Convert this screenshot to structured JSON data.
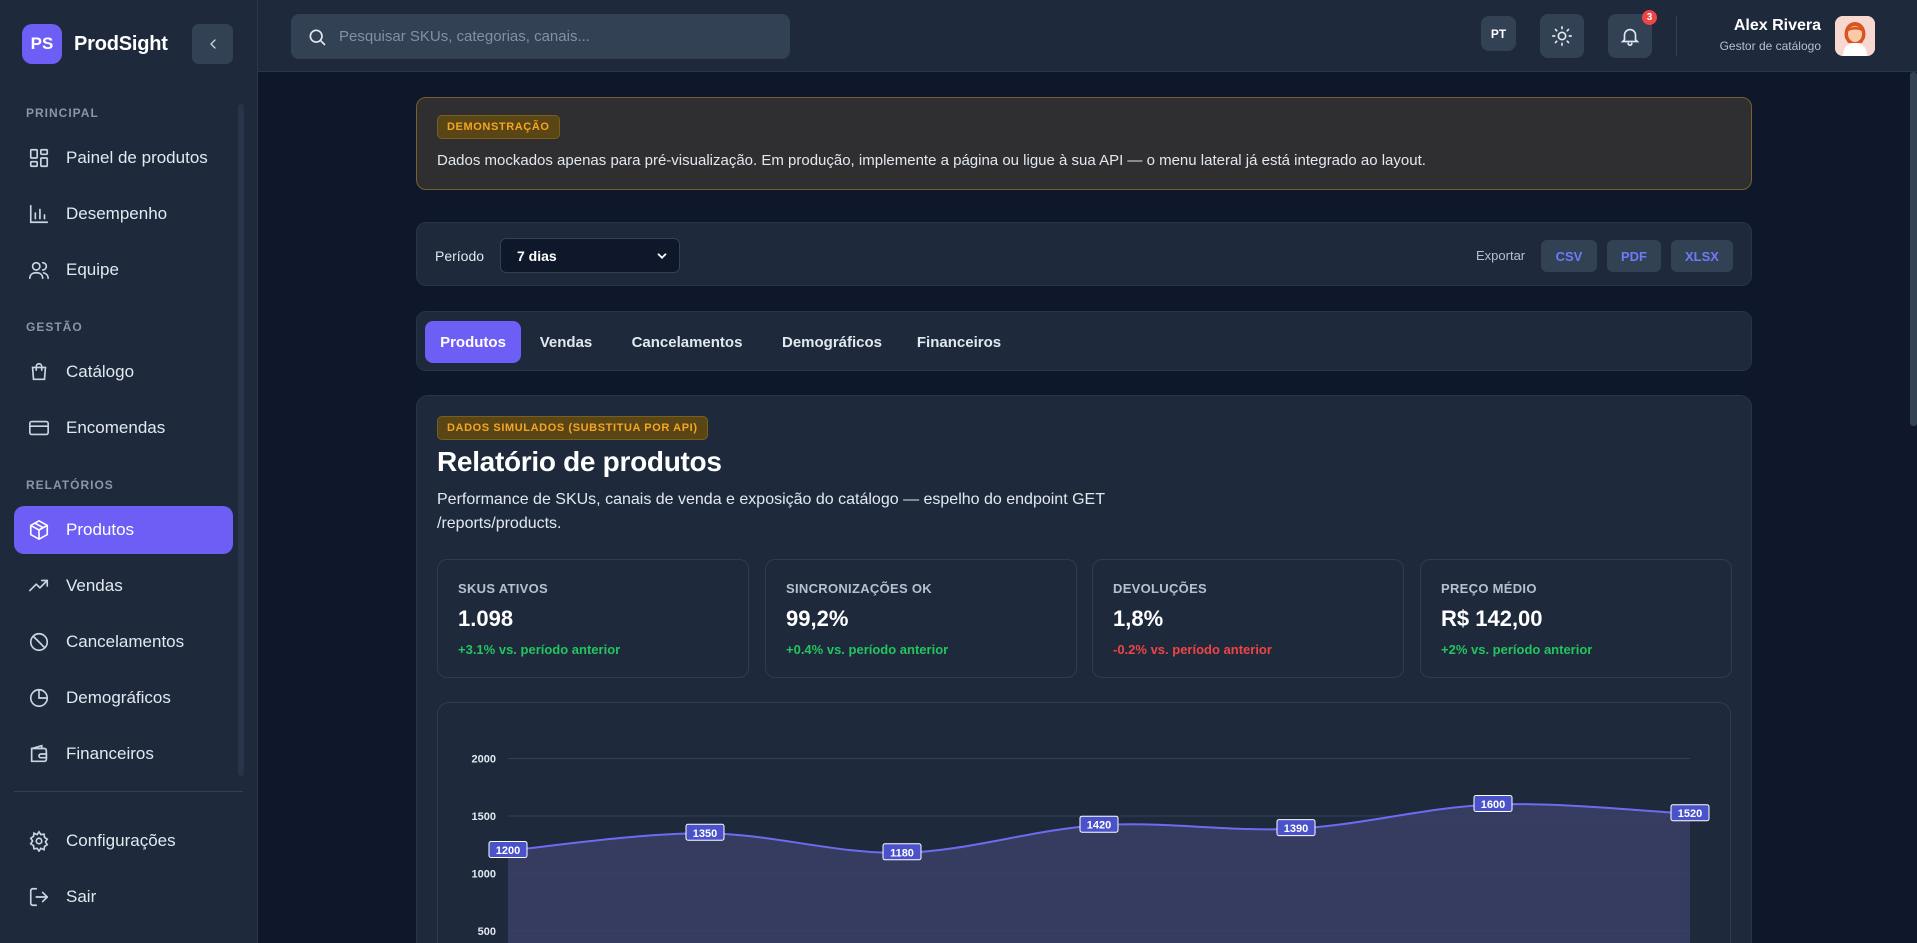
{
  "brand": {
    "logo": "PS",
    "name": "ProdSight"
  },
  "sidebar": {
    "sections": {
      "principal": "PRINCIPAL",
      "gestao": "GESTÃO",
      "relatorios": "RELATÓRIOS"
    },
    "items": {
      "painel": "Painel de produtos",
      "desempenho": "Desempenho",
      "equipe": "Equipe",
      "catalogo": "Catálogo",
      "encomendas": "Encomendas",
      "produtos": "Produtos",
      "vendas": "Vendas",
      "cancelamentos": "Cancelamentos",
      "demograficos": "Demográficos",
      "financeiros": "Financeiros",
      "configuracoes": "Configurações",
      "sair": "Sair"
    },
    "active_item": "Produtos"
  },
  "topbar": {
    "search_placeholder": "Pesquisar SKUs, categorias, canais...",
    "language": "PT",
    "notifications_count": "3",
    "user_name": "Alex Rivera",
    "user_role": "Gestor de catálogo"
  },
  "banner": {
    "badge": "DEMONSTRAÇÃO",
    "text": "Dados mockados apenas para pré-visualização. Em produção, implemente a página ou ligue à sua API — o menu lateral já está integrado ao layout."
  },
  "filters": {
    "period_label": "Período",
    "period_value": "7 dias",
    "export_label": "Exportar",
    "export_buttons": [
      "CSV",
      "PDF",
      "XLSX"
    ]
  },
  "tabs": [
    "Produtos",
    "Vendas",
    "Cancelamentos",
    "Demográficos",
    "Financeiros"
  ],
  "report": {
    "badge": "DADOS SIMULADOS (SUBSTITUA POR API)",
    "title": "Relatório de produtos",
    "subtitle": "Performance de SKUs, canais de venda e exposição do catálogo — espelho do endpoint GET /reports/products.",
    "kpis": [
      {
        "label": "SKUS ATIVOS",
        "value": "1.098",
        "delta": "+3.1% vs. período anterior",
        "trend": "up"
      },
      {
        "label": "SINCRONIZAÇÕES OK",
        "value": "99,2%",
        "delta": "+0.4% vs. período anterior",
        "trend": "up"
      },
      {
        "label": "DEVOLUÇÕES",
        "value": "1,8%",
        "delta": "-0.2% vs. período anterior",
        "trend": "down"
      },
      {
        "label": "PREÇO MÉDIO",
        "value": "R$ 142,00",
        "delta": "+2% vs. período anterior",
        "trend": "up"
      }
    ]
  },
  "chart_data": {
    "type": "area",
    "y_ticks": [
      2000,
      1500,
      1000,
      500
    ],
    "ylim": [
      0,
      2000
    ],
    "values": [
      1200,
      1350,
      1180,
      1420,
      1390,
      1600,
      1520
    ],
    "grid": true,
    "line_color": "#6d6cf0",
    "fill_color": "#3a3f66"
  },
  "colors": {
    "accent": "#6d5ef5",
    "positive": "#22c55e",
    "negative": "#ef4444",
    "warning": "#f5a524"
  }
}
